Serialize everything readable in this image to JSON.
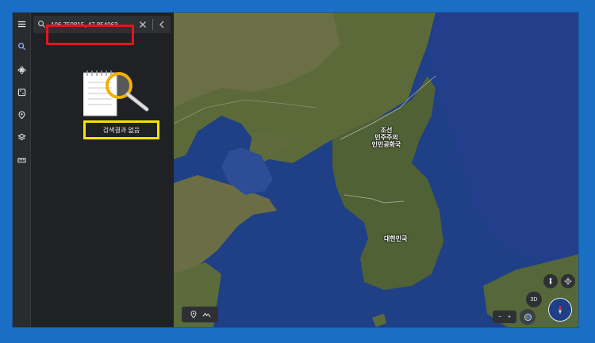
{
  "search": {
    "value": "106.759815, 47.854063",
    "placeholder": ""
  },
  "results": {
    "empty_message": "검색결과 없음"
  },
  "rail": {
    "items": [
      {
        "name": "menu-icon"
      },
      {
        "name": "search-icon"
      },
      {
        "name": "voyager-icon"
      },
      {
        "name": "random-dice-icon"
      },
      {
        "name": "projects-pin-icon"
      },
      {
        "name": "map-style-layers-icon"
      },
      {
        "name": "measure-ruler-icon"
      }
    ]
  },
  "map": {
    "labels": {
      "north_korea": "조선\n민주주의\n인민공화국",
      "south_korea": "대한민국",
      "bohai": "",
      "yellow_sea": "",
      "japan": "",
      "cities": [
        "",
        "",
        ""
      ]
    },
    "zoom_mode": "3D"
  },
  "colors": {
    "search_highlight": "#e5141c",
    "result_highlight": "#f5e400",
    "page_background": "#1a6fc4",
    "sea": "#1f3f86",
    "land": "#5b6a3c"
  }
}
